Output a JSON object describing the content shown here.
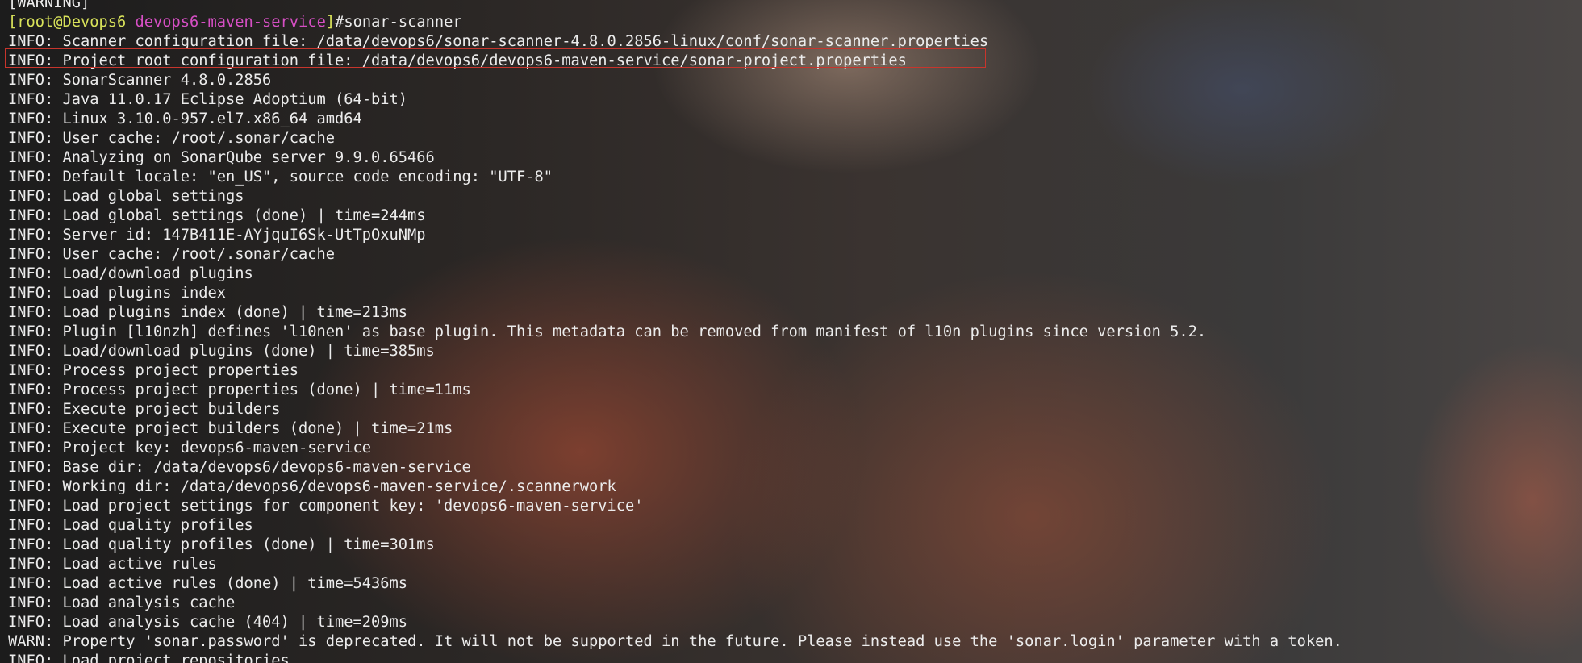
{
  "terminal": {
    "first_line": "[WARNING]",
    "prompt": {
      "open_bracket": "[",
      "user_host": "root@Devops6",
      "space": " ",
      "path": "devops6-maven-service",
      "close_bracket": "]",
      "command": "#sonar-scanner"
    },
    "highlighted_line_index": 1,
    "lines": [
      "INFO: Scanner configuration file: /data/devops6/sonar-scanner-4.8.0.2856-linux/conf/sonar-scanner.properties",
      "INFO: Project root configuration file: /data/devops6/devops6-maven-service/sonar-project.properties",
      "INFO: SonarScanner 4.8.0.2856",
      "INFO: Java 11.0.17 Eclipse Adoptium (64-bit)",
      "INFO: Linux 3.10.0-957.el7.x86_64 amd64",
      "INFO: User cache: /root/.sonar/cache",
      "INFO: Analyzing on SonarQube server 9.9.0.65466",
      "INFO: Default locale: \"en_US\", source code encoding: \"UTF-8\"",
      "INFO: Load global settings",
      "INFO: Load global settings (done) | time=244ms",
      "INFO: Server id: 147B411E-AYjquI6Sk-UtTpOxuNMp",
      "INFO: User cache: /root/.sonar/cache",
      "INFO: Load/download plugins",
      "INFO: Load plugins index",
      "INFO: Load plugins index (done) | time=213ms",
      "INFO: Plugin [l10nzh] defines 'l10nen' as base plugin. This metadata can be removed from manifest of l10n plugins since version 5.2.",
      "INFO: Load/download plugins (done) | time=385ms",
      "INFO: Process project properties",
      "INFO: Process project properties (done) | time=11ms",
      "INFO: Execute project builders",
      "INFO: Execute project builders (done) | time=21ms",
      "INFO: Project key: devops6-maven-service",
      "INFO: Base dir: /data/devops6/devops6-maven-service",
      "INFO: Working dir: /data/devops6/devops6-maven-service/.scannerwork",
      "INFO: Load project settings for component key: 'devops6-maven-service'",
      "INFO: Load quality profiles",
      "INFO: Load quality profiles (done) | time=301ms",
      "INFO: Load active rules",
      "INFO: Load active rules (done) | time=5436ms",
      "INFO: Load analysis cache",
      "INFO: Load analysis cache (404) | time=209ms",
      "WARN: Property 'sonar.password' is deprecated. It will not be supported in the future. Please instead use the 'sonar.login' parameter with a token.",
      "INFO: Load project repositories"
    ]
  }
}
